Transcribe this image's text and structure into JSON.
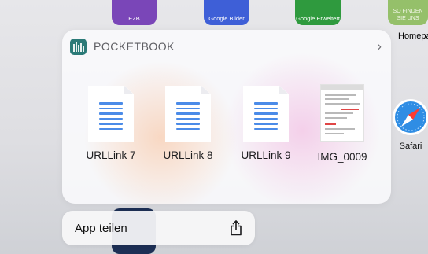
{
  "background_apps": [
    {
      "label": "EZB"
    },
    {
      "label": "Google Bilder"
    },
    {
      "label": "Google Erweitert"
    },
    {
      "label": "SO FINDEN SIE UNS"
    }
  ],
  "side_label": "Homepag",
  "safari": {
    "label": "Safari"
  },
  "widget": {
    "app_name": "POCKETBOOK",
    "chevron": "›",
    "files": [
      {
        "label": "URLLink 7",
        "icon": "document-icon"
      },
      {
        "label": "URLLink 8",
        "icon": "document-icon"
      },
      {
        "label": "URLLink 9",
        "icon": "document-icon"
      },
      {
        "label": "IMG_0009",
        "icon": "image-thumbnail"
      }
    ]
  },
  "share": {
    "label": "App teilen",
    "icon": "share-icon"
  },
  "colors": {
    "doc_lines": "#4b8be8",
    "app_icon": "#2b7a77"
  }
}
